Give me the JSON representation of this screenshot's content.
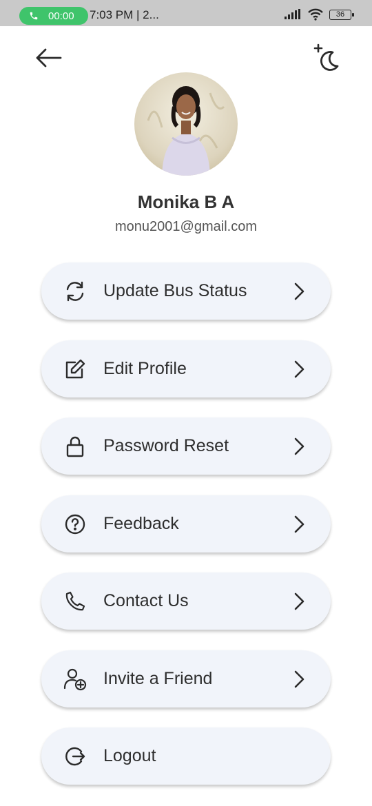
{
  "status_bar": {
    "call_timer": "00:00",
    "time_text": "7:03 PM | 2...",
    "battery": "36"
  },
  "header": {
    "back_icon": "arrow-left-icon",
    "theme_icon": "moon-star-icon"
  },
  "profile": {
    "name": "Monika B A",
    "email": "monu2001@gmail.com"
  },
  "menu": {
    "items": [
      {
        "label": "Update Bus Status",
        "icon": "refresh-icon"
      },
      {
        "label": "Edit Profile",
        "icon": "edit-icon"
      },
      {
        "label": "Password Reset",
        "icon": "lock-icon"
      },
      {
        "label": "Feedback",
        "icon": "help-circle-icon"
      },
      {
        "label": "Contact Us",
        "icon": "phone-icon"
      },
      {
        "label": "Invite a Friend",
        "icon": "user-plus-icon"
      },
      {
        "label": "Logout",
        "icon": "logout-icon"
      }
    ]
  },
  "colors": {
    "call_pill": "#3fc46b",
    "card_bg": "#f1f4fa",
    "status_bar_bg": "#c9c9c9"
  }
}
